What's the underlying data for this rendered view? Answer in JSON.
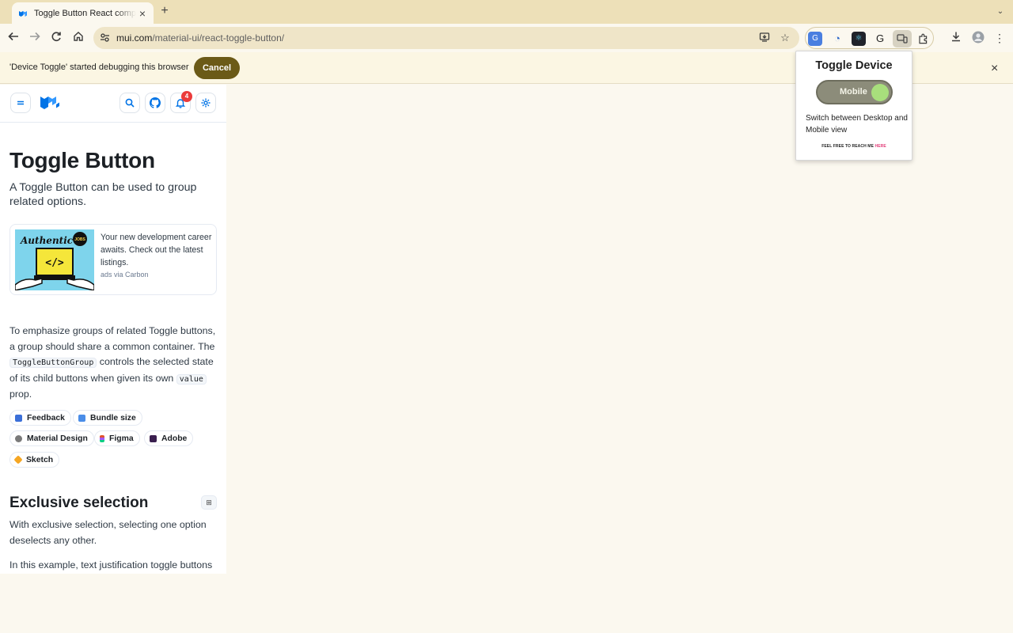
{
  "browser": {
    "tab_title": "Toggle Button React component - Material UI",
    "url_host": "mui.com",
    "url_path": "/material-ui/react-toggle-button/"
  },
  "infobar": {
    "message": "'Device Toggle' started debugging this browser",
    "cancel_label": "Cancel"
  },
  "header": {
    "notification_count": "4"
  },
  "page": {
    "title": "Toggle Button",
    "subtitle": "A Toggle Button can be used to group related options.",
    "ad_text": "Your new development career awaits. Check out the latest listings.",
    "ad_via": "ads via Carbon",
    "ad_image_script": "Authentic",
    "ad_image_badge": "JOBS",
    "intro_1": "To emphasize groups of related Toggle buttons, a group should share a common container. The ",
    "intro_code_1": "ToggleButtonGroup",
    "intro_2": " controls the selected state of its child buttons when given its own ",
    "intro_code_2": "value",
    "intro_3": " prop.",
    "chips": [
      {
        "label": "Feedback",
        "color": "#3b6fd8"
      },
      {
        "label": "Bundle size",
        "color": "#4a8de8"
      },
      {
        "label": "Material Design",
        "color": "#7a7a7a"
      },
      {
        "label": "Figma",
        "color": "#e0532e"
      },
      {
        "label": "Adobe",
        "color": "#3a1f4f"
      },
      {
        "label": "Sketch",
        "color": "#f5a623"
      }
    ],
    "section_title": "Exclusive selection",
    "section_text": "With exclusive selection, selecting one option deselects any other.",
    "section_text_2": "In this example, text justification toggle buttons"
  },
  "popup": {
    "title": "Toggle Device",
    "toggle_label": "Mobile",
    "toggle_state": "on",
    "description": "Switch between Desktop and Mobile view",
    "footer": "FEEL FREE TO REACH ME",
    "footer_link": "HERE"
  },
  "colors": {
    "mui_blue": "#0073e6",
    "cancel_bg": "#6b5a17",
    "toggle_knob": "#a8df7c",
    "notification_badge": "#eb3b3b"
  }
}
